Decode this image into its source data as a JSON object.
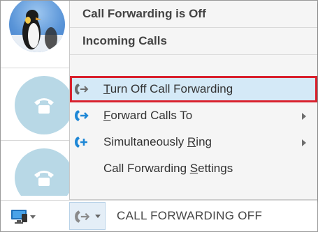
{
  "menu": {
    "status_header": "Call Forwarding is Off",
    "section_header": "Incoming Calls",
    "items": [
      {
        "label_prefix": "",
        "label_access": "T",
        "label_rest": "urn Off Call Forwarding",
        "icon": "call-forward-icon",
        "selected": true,
        "submenu": false
      },
      {
        "label_prefix": "",
        "label_access": "F",
        "label_rest": "orward Calls To",
        "icon": "forward-arrow-icon",
        "selected": false,
        "submenu": true
      },
      {
        "label_prefix": "Simultaneously ",
        "label_access": "R",
        "label_rest": "ing",
        "icon": "simultaneous-ring-icon",
        "selected": false,
        "submenu": true
      },
      {
        "label_prefix": "Call Forwarding ",
        "label_access": "S",
        "label_rest": "ettings",
        "icon": "",
        "selected": false,
        "submenu": false
      }
    ]
  },
  "statusbar": {
    "forward_status_text": "CALL FORWARDING OFF",
    "device_icon": "monitor-icon",
    "forward_icon": "call-forward-icon"
  },
  "colors": {
    "highlight_bg": "#d4e9f7",
    "highlight_border": "#d9212d",
    "forward_blue": "#1e87d6",
    "phone_circle": "#b8d8e6"
  }
}
